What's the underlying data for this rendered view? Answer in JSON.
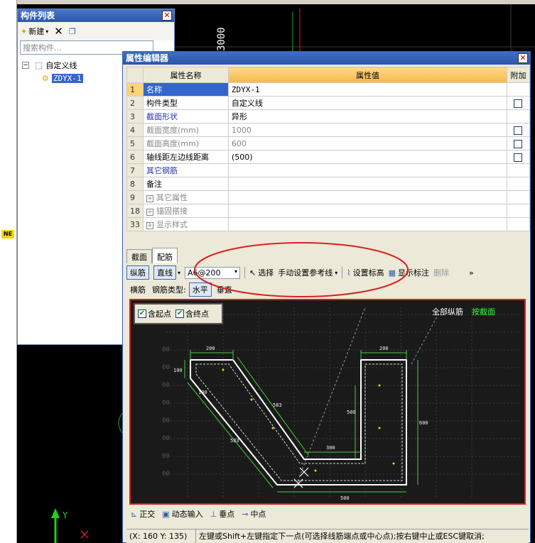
{
  "component_panel": {
    "title": "构件列表",
    "new_label": "新建",
    "search_placeholder": "搜索构件...",
    "tree_root": "自定义线",
    "tree_child": "ZDYX-1"
  },
  "canvas": {
    "dimension_text": "3000",
    "ne_label": "NE",
    "axis_y": "Y",
    "axis_x": "X"
  },
  "editor": {
    "title": "属性编辑器",
    "headers": {
      "name": "属性名称",
      "value": "属性值",
      "extra": "附加"
    },
    "rows": [
      {
        "num": "1",
        "name": "名称",
        "value": "ZDYX-1",
        "check": false
      },
      {
        "num": "2",
        "name": "构件类型",
        "value": "自定义线",
        "check": true
      },
      {
        "num": "3",
        "name": "截面形状",
        "value": "异形",
        "check": false
      },
      {
        "num": "4",
        "name": "截面宽度(mm)",
        "value": "1000",
        "check": true
      },
      {
        "num": "5",
        "name": "截面高度(mm)",
        "value": "600",
        "check": true
      },
      {
        "num": "6",
        "name": "轴线距左边线距离",
        "value": "(500)",
        "check": true
      },
      {
        "num": "7",
        "name": "其它钢筋",
        "value": "",
        "check": false
      },
      {
        "num": "8",
        "name": "备注",
        "value": "",
        "check": false
      },
      {
        "num": "9",
        "name": "其它属性",
        "value": "",
        "check": false
      },
      {
        "num": "18",
        "name": "锚固搭接",
        "value": "",
        "check": false
      },
      {
        "num": "33",
        "name": "显示样式",
        "value": "",
        "check": false
      }
    ],
    "tabs": {
      "t1": "截面",
      "t2": "配筋"
    },
    "toolbar1": {
      "longitudinal": "纵筋",
      "line": "直线",
      "rebar_value": "A6@200",
      "select": "选择",
      "manual_ref": "手动设置参考线",
      "set_elev": "设置标高",
      "show_label": "显示标注",
      "delete": "删除",
      "more": "»"
    },
    "toolbar2": {
      "transverse": "横筋",
      "rebar_type": "钢筋类型:",
      "horizontal": "水平",
      "vertical": "垂直"
    },
    "drawing": {
      "start_pt": "含起点",
      "end_pt": "含终点",
      "all_long": "全部纵筋",
      "by_section": "按截面",
      "dims": {
        "d200a": "200",
        "d200b": "200",
        "d100a": "100",
        "d100b": "100",
        "d583a": "583",
        "d583b": "583",
        "d500a": "500",
        "d300": "300",
        "d600": "600",
        "d500b": "500"
      },
      "y_label": "00"
    },
    "snap": {
      "ortho": "正交",
      "dyn": "动态输入",
      "perp": "垂点",
      "mid": "中点"
    },
    "status": {
      "coord": "(X: 160 Y: 135)",
      "hint": "左键或Shift+左键指定下一点(可选择线筋端点或中心点);按右键中止或ESC键取消;"
    }
  }
}
